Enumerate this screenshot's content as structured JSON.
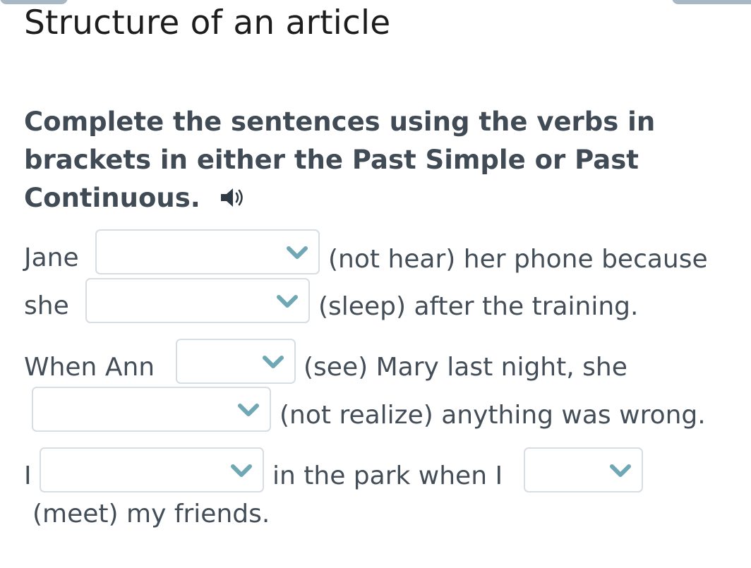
{
  "header": {
    "title": "Structure of an article"
  },
  "exercise": {
    "instruction_lines": [
      "Complete the sentences using the verbs in",
      "brackets in either the Past Simple or Past",
      "Continuous."
    ],
    "audio_icon": "speaker-icon"
  },
  "sentences": [
    {
      "segments": [
        "Jane",
        "(not hear) her phone because",
        "she",
        "(sleep) after the training."
      ],
      "blanks": [
        {
          "value": ""
        },
        {
          "value": ""
        }
      ]
    },
    {
      "segments": [
        "When Ann",
        "(see) Mary last night, she",
        "(not realize) anything was wrong."
      ],
      "blanks": [
        {
          "value": ""
        },
        {
          "value": ""
        }
      ]
    },
    {
      "segments": [
        "I",
        "in the park when I",
        "(meet) my friends."
      ],
      "blanks": [
        {
          "value": ""
        },
        {
          "value": ""
        }
      ]
    }
  ],
  "colors": {
    "chevron": "#6fa7b5",
    "select_border": "#d6dde3",
    "heading_text": "#404b55",
    "body_text": "#444e58"
  }
}
